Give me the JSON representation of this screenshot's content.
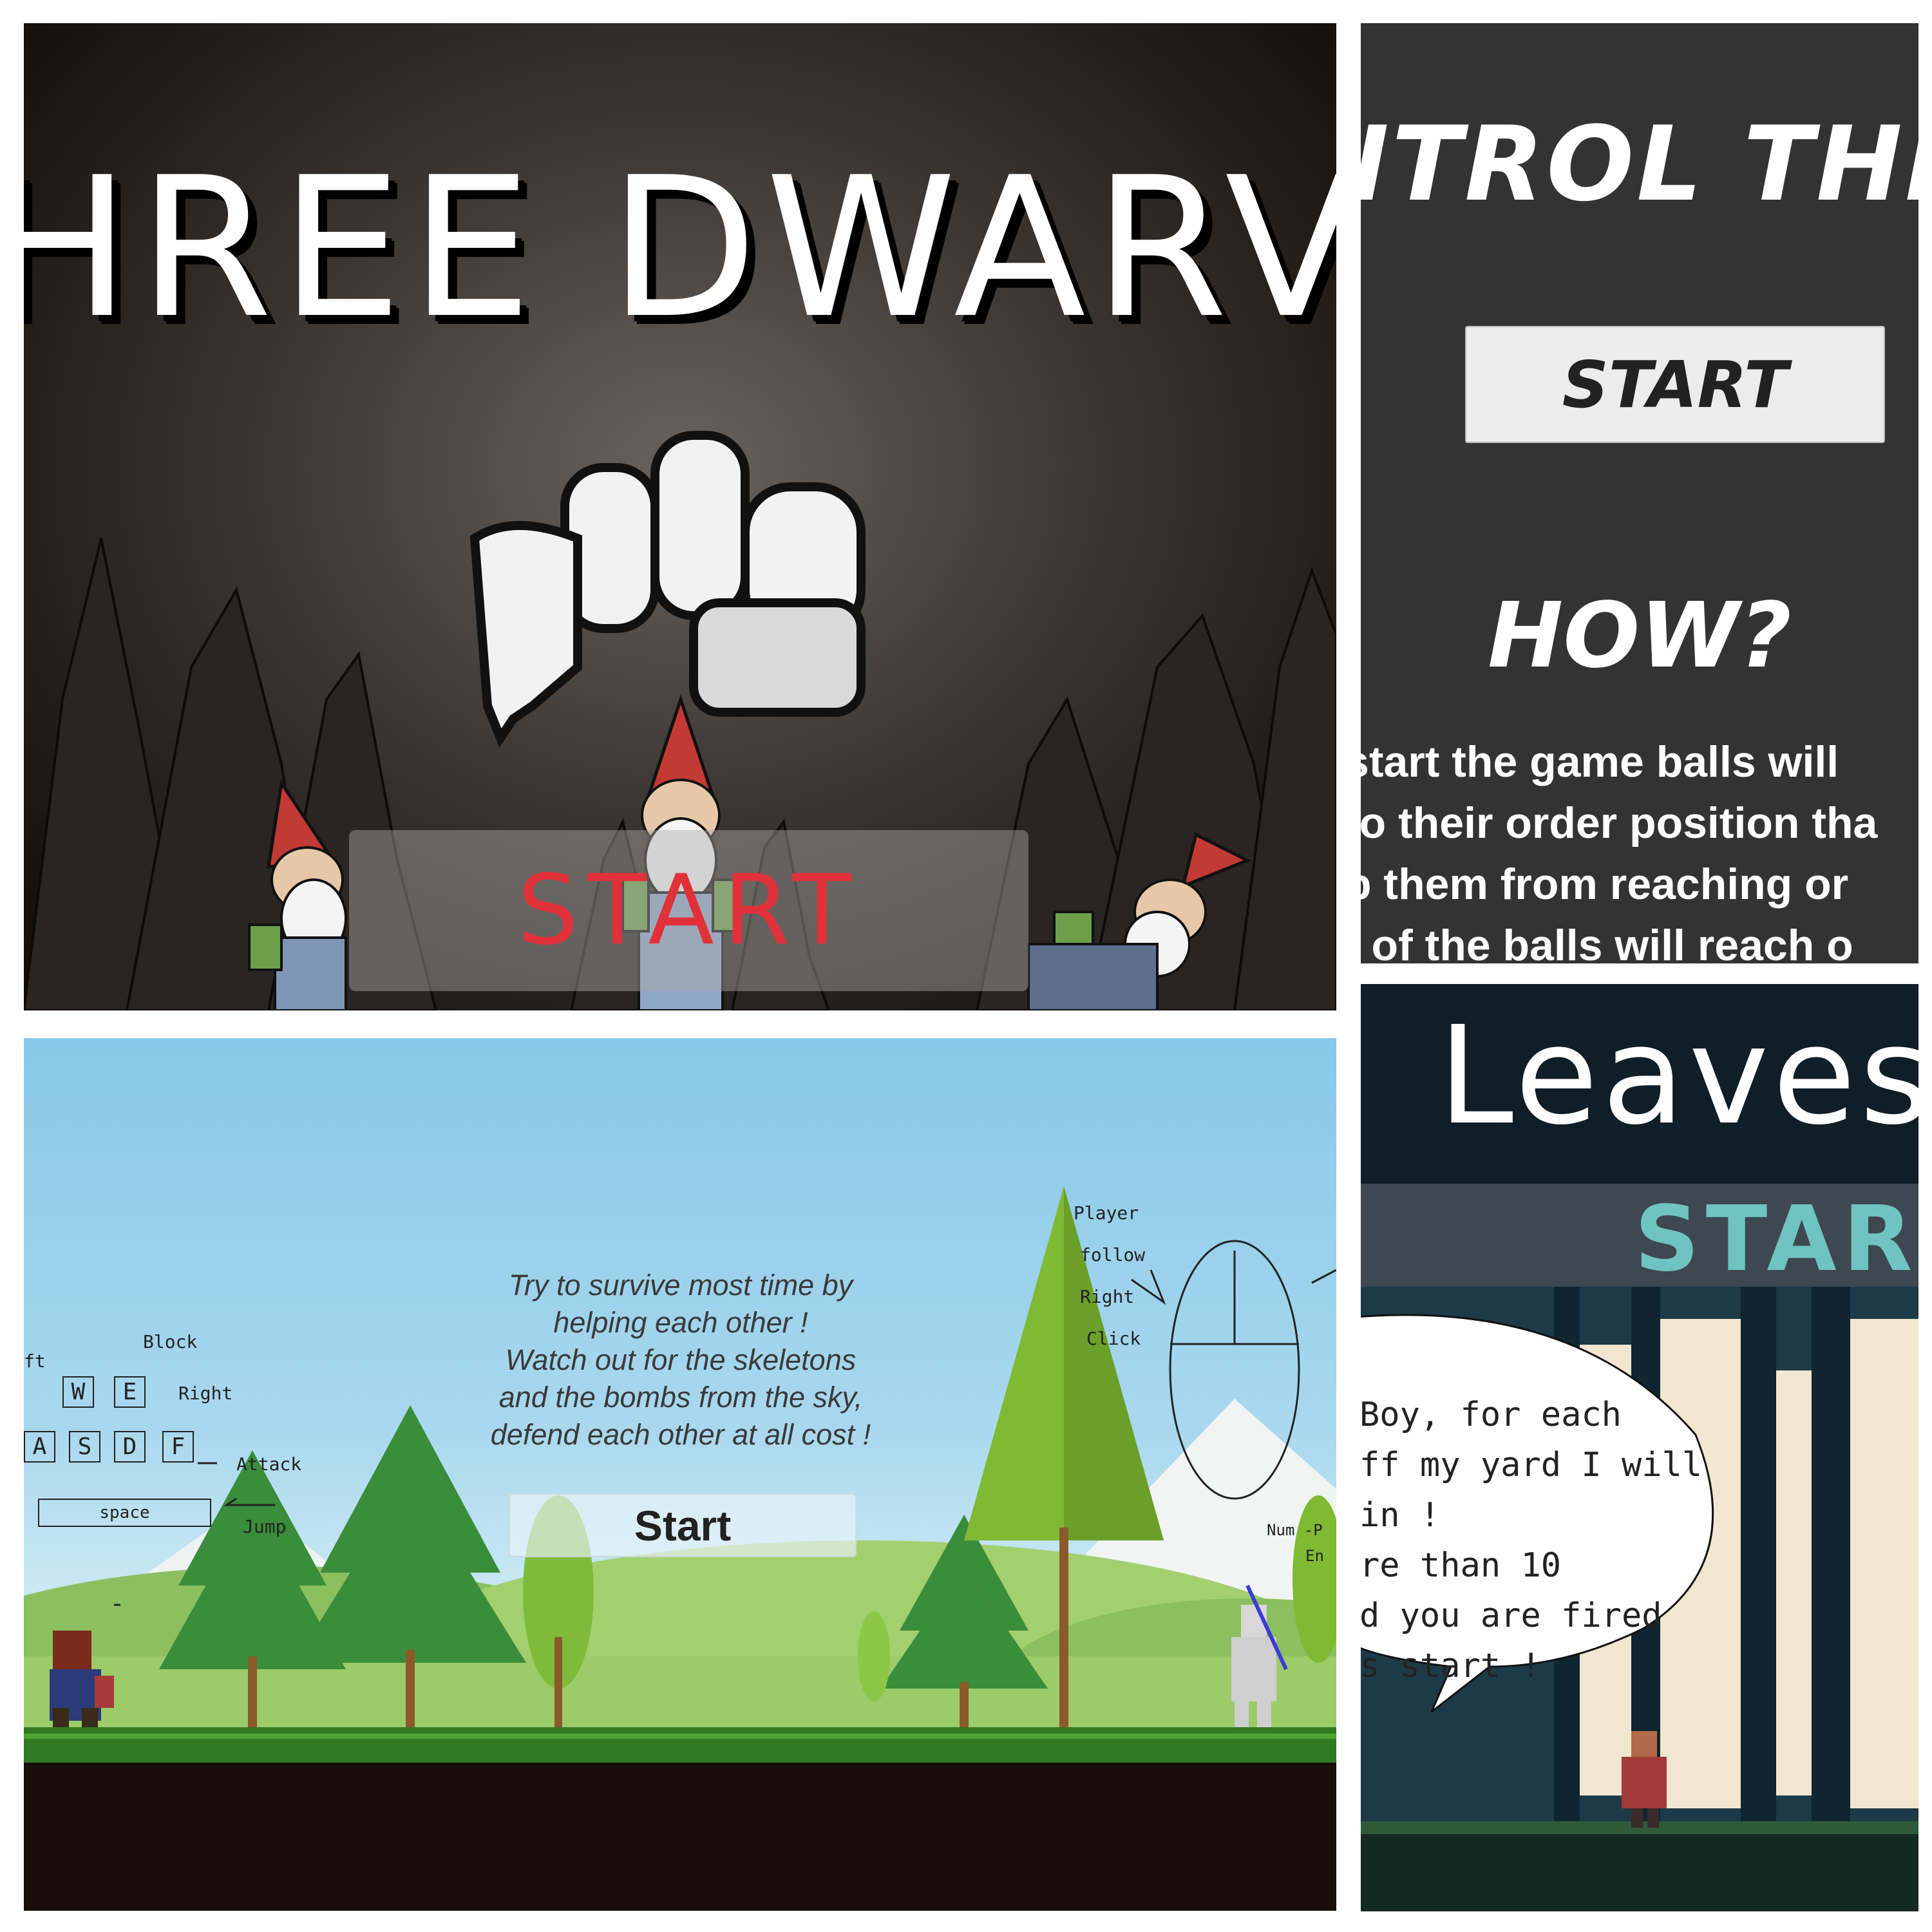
{
  "panels": {
    "three_dwarves": {
      "title": "HREE DWARVE",
      "start_label": "START"
    },
    "control": {
      "title": "NTROL THE C",
      "start_label": "START",
      "how_label": "HOW?",
      "lines": [
        "start the game balls will",
        "to their order position tha",
        "p them from reaching or",
        "f of the balls will reach o"
      ]
    },
    "survive": {
      "instructions": [
        "Try to survive most time by",
        "helping each other !",
        "Watch out for the skeletons",
        "and the bombs from the sky,",
        "defend each other at all cost !"
      ],
      "start_label": "Start",
      "notes": {
        "block": "Block",
        "right": "Right",
        "attack": "Attack",
        "jump": "Jump",
        "left_cut": "ft",
        "space": "space",
        "player": "Player",
        "follow": "follow",
        "right2": "Right",
        "click": "Click",
        "num": "Num -P",
        "en": "En"
      },
      "keys": [
        "W",
        "E",
        "A",
        "S",
        "D",
        "F"
      ]
    },
    "leaves": {
      "title": "Leaves",
      "start_label": "STAR",
      "bubble_lines": [
        "Boy, for each",
        "ff my yard I will",
        "in !",
        "re than 10",
        "d you are fired",
        "s start !"
      ]
    }
  },
  "colors": {
    "start_red": "#e0313a",
    "leaves_teal": "#6fc3c0",
    "control_bg": "#333333"
  }
}
